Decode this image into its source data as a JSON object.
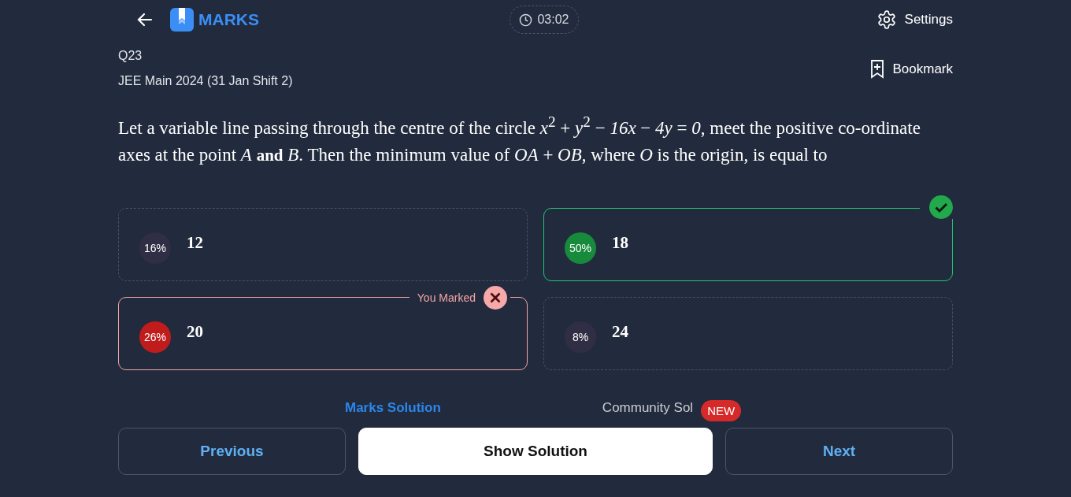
{
  "header": {
    "brand": "MARKS",
    "timer": "03:02",
    "settings": "Settings"
  },
  "question": {
    "number": "Q23",
    "source": "JEE Main 2024 (31 Jan Shift 2)",
    "bookmark": "Bookmark",
    "text": "Let a variable line passing through the centre of the circle *x*$^{2}$ + *y*$^{2}$ − *16x* − *4y* = *0*, meet the positive co-ordinate axes at the point *A* **and** *B*. Then the minimum value of *OA* + *OB*, where *O* is the origin, is equal to"
  },
  "options": [
    {
      "percent": "16%",
      "value": "12",
      "correct": false,
      "marked": false
    },
    {
      "percent": "50%",
      "value": "18",
      "correct": true,
      "marked": false
    },
    {
      "percent": "26%",
      "value": "20",
      "correct": false,
      "marked": true,
      "marked_label": "You Marked"
    },
    {
      "percent": "8%",
      "value": "24",
      "correct": false,
      "marked": false
    }
  ],
  "solution_tabs": [
    {
      "label": "Marks Solution",
      "selected": true
    },
    {
      "label": "Community Sol",
      "selected": false,
      "badge": "NEW"
    }
  ],
  "buttons": [
    {
      "label": "Previous",
      "kind": "outline"
    },
    {
      "label": "Show Solution",
      "kind": "primary"
    },
    {
      "label": "Next",
      "kind": "outline"
    }
  ]
}
